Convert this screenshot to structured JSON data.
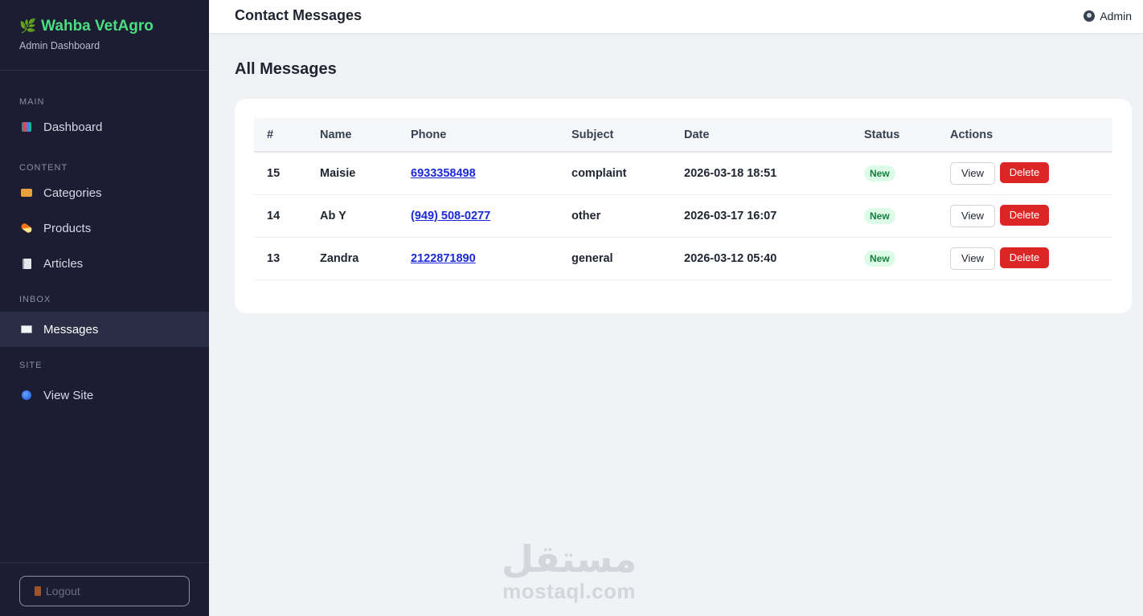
{
  "brand": {
    "title": "Wahba VetAgro",
    "subtitle": "Admin Dashboard"
  },
  "sidebar": {
    "sections": [
      {
        "label": "MAIN",
        "items": [
          {
            "label": "Dashboard",
            "icon": "chart-icon"
          }
        ]
      },
      {
        "label": "CONTENT",
        "items": [
          {
            "label": "Categories",
            "icon": "folder-icon"
          },
          {
            "label": "Products",
            "icon": "pill-icon"
          },
          {
            "label": "Articles",
            "icon": "memo-icon"
          }
        ]
      },
      {
        "label": "INBOX",
        "items": [
          {
            "label": "Messages",
            "icon": "envelope-icon",
            "active": true
          }
        ]
      },
      {
        "label": "SITE",
        "items": [
          {
            "label": "View Site",
            "icon": "globe-icon"
          }
        ]
      }
    ],
    "logout_label": "Logout"
  },
  "topbar": {
    "title": "Contact Messages",
    "user_label": "Admin"
  },
  "main": {
    "heading": "All Messages",
    "table": {
      "headers": [
        "#",
        "Name",
        "Phone",
        "Subject",
        "Date",
        "Status",
        "Actions"
      ],
      "rows": [
        {
          "id": "15",
          "name": "Maisie",
          "phone": "6933358498",
          "subject": "complaint",
          "date": "2026-03-18 18:51",
          "status": "New"
        },
        {
          "id": "14",
          "name": "Ab Y",
          "phone": "(949) 508-0277",
          "subject": "other",
          "date": "2026-03-17 16:07",
          "status": "New"
        },
        {
          "id": "13",
          "name": "Zandra",
          "phone": "2122871890",
          "subject": "general",
          "date": "2026-03-12 05:40",
          "status": "New"
        }
      ],
      "view_label": "View",
      "delete_label": "Delete"
    }
  },
  "watermark": {
    "arabic": "مستقل",
    "latin": "mostaql.com"
  },
  "colors": {
    "sidebar_bg": "#1c1d33",
    "brand_green": "#4ade80",
    "delete_red": "#dc2626",
    "badge_green": "#dcfce7",
    "link_blue": "#1a2ad8"
  }
}
